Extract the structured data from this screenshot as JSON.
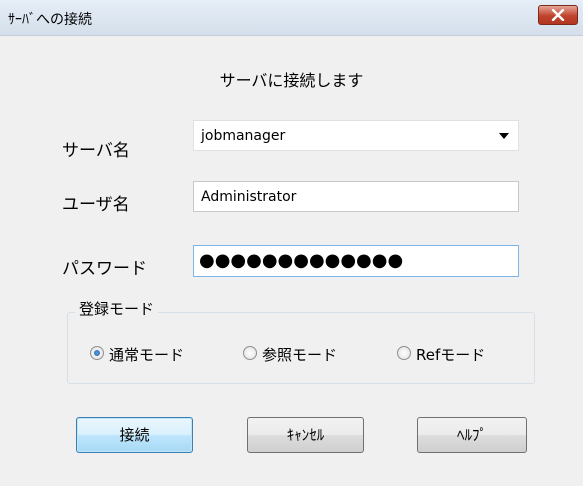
{
  "window": {
    "title": "ｻｰﾊﾞへの接続",
    "close_icon": "close-icon"
  },
  "subtitle": "サーバに接続します",
  "form": {
    "server_label": "サーバ名",
    "server_value": "jobmanager",
    "user_label": "ユーザ名",
    "user_value": "Administrator",
    "password_label": "パスワード",
    "password_mask": "●●●●●●●●●●●●●"
  },
  "registration": {
    "legend": "登録モード",
    "options": [
      {
        "label": "通常モード",
        "checked": true
      },
      {
        "label": "参照モード",
        "checked": false
      },
      {
        "label": "Refモード",
        "checked": false
      }
    ]
  },
  "buttons": {
    "connect": "接続",
    "cancel": "ｷｬﾝｾﾙ",
    "help": "ﾍﾙﾌﾟ"
  },
  "colors": {
    "close_button": "#c0432e",
    "accent_focus": "#7eb4ea",
    "radio_selected": "#1c5fa8"
  }
}
